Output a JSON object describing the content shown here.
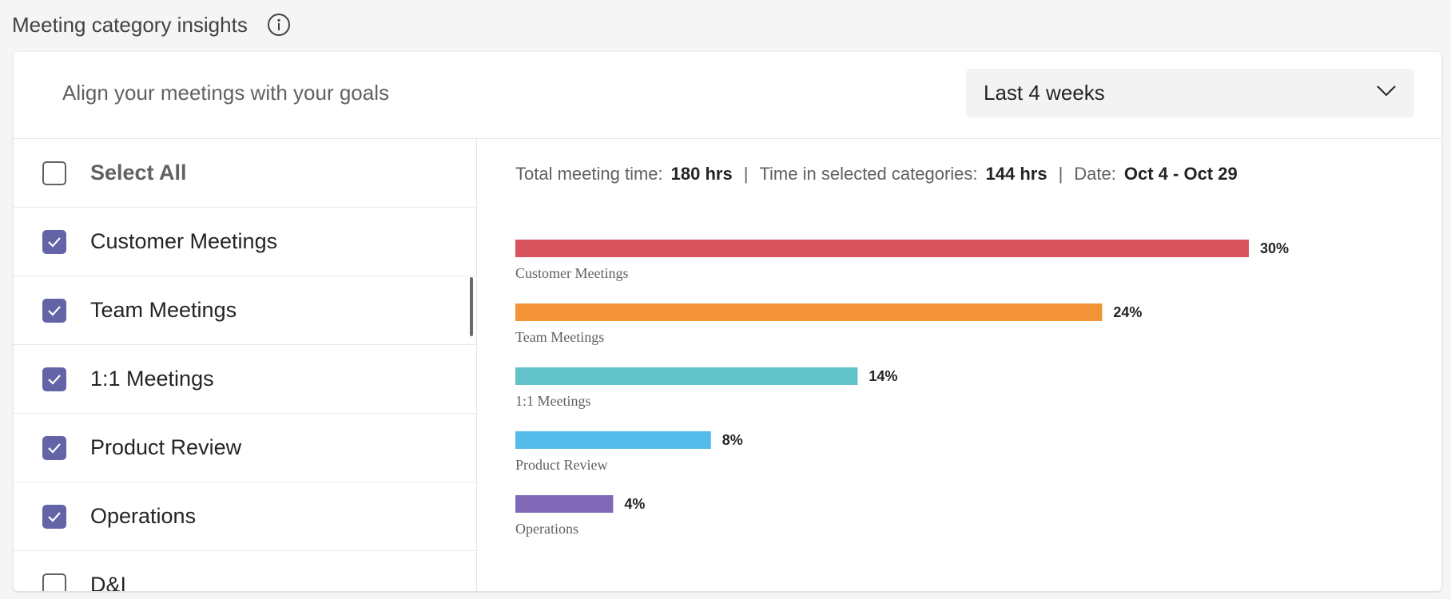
{
  "page": {
    "title": "Meeting category insights"
  },
  "card": {
    "subtitle": "Align your meetings with your goals",
    "dropdown": {
      "selected": "Last 4 weeks"
    }
  },
  "categories": [
    {
      "label": "Select All",
      "checked": false
    },
    {
      "label": "Customer Meetings",
      "checked": true
    },
    {
      "label": "Team Meetings",
      "checked": true
    },
    {
      "label": "1:1 Meetings",
      "checked": true
    },
    {
      "label": "Product Review",
      "checked": true
    },
    {
      "label": "Operations",
      "checked": true
    },
    {
      "label": "D&I",
      "checked": false
    }
  ],
  "summary": {
    "total_label": "Total meeting time:",
    "total_value": "180 hrs",
    "selected_label": "Time in selected categories:",
    "selected_value": "144 hrs",
    "date_label": "Date:",
    "date_value": "Oct 4 - Oct 29"
  },
  "colors": {
    "accent": "#6264a7"
  },
  "chart_data": {
    "type": "bar",
    "orientation": "horizontal",
    "categories": [
      "Customer Meetings",
      "Team Meetings",
      "1:1 Meetings",
      "Product Review",
      "Operations"
    ],
    "values": [
      30,
      24,
      14,
      8,
      4
    ],
    "value_labels": [
      "30%",
      "24%",
      "14%",
      "8%",
      "4%"
    ],
    "colors": [
      "#d9545e",
      "#f19336",
      "#62c3ca",
      "#55bbea",
      "#7f69b7"
    ],
    "xlim": [
      0,
      30
    ]
  }
}
